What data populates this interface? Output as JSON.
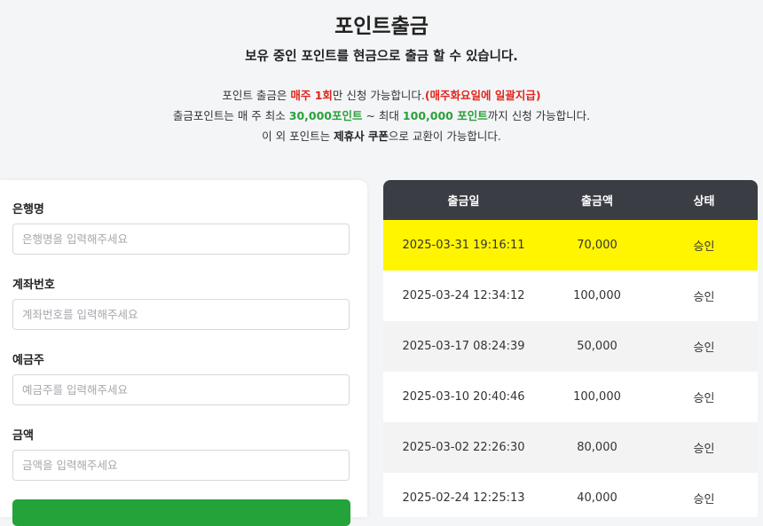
{
  "header": {
    "title": "포인트출금",
    "subtitle": "보유 중인 포인트를 현금으로 출금 할 수 있습니다.",
    "line1": {
      "a": "포인트 출금은 ",
      "b": "매주 1회",
      "c": "만 신청 가능합니다.",
      "d": "(매주화요일에 일괄지급)"
    },
    "line2": {
      "a": "출금포인트는 매 주 최소 ",
      "b": "30,000포인트",
      "c": " ~ 최대 ",
      "d": "100,000 포인트",
      "e": "까지 신청 가능합니다."
    },
    "line3": {
      "a": "이 외 포인트는 ",
      "b": "제휴사 쿠폰",
      "c": "으로 교환이 가능합니다."
    }
  },
  "form": {
    "bank": {
      "label": "은행명",
      "placeholder": "은행명을 입력해주세요",
      "value": ""
    },
    "account": {
      "label": "계좌번호",
      "placeholder": "계좌번호를 입력해주세요",
      "value": ""
    },
    "holder": {
      "label": "예금주",
      "placeholder": "예금주를 입력해주세요",
      "value": ""
    },
    "amount": {
      "label": "금액",
      "placeholder": "금액을 입력해주세요",
      "value": ""
    }
  },
  "colors": {
    "submit": "#23a33a",
    "table_header": "#3a3d44",
    "highlight": "#fff500",
    "red": "#e1261c",
    "green": "#2aa13a"
  },
  "table": {
    "headers": [
      "출금일",
      "출금액",
      "상태"
    ],
    "rows": [
      {
        "date": "2025-03-31 19:16:11",
        "amount": "70,000",
        "status": "승인"
      },
      {
        "date": "2025-03-24 12:34:12",
        "amount": "100,000",
        "status": "승인"
      },
      {
        "date": "2025-03-17 08:24:39",
        "amount": "50,000",
        "status": "승인"
      },
      {
        "date": "2025-03-10 20:40:46",
        "amount": "100,000",
        "status": "승인"
      },
      {
        "date": "2025-03-02 22:26:30",
        "amount": "80,000",
        "status": "승인"
      },
      {
        "date": "2025-02-24 12:25:13",
        "amount": "40,000",
        "status": "승인"
      }
    ]
  }
}
